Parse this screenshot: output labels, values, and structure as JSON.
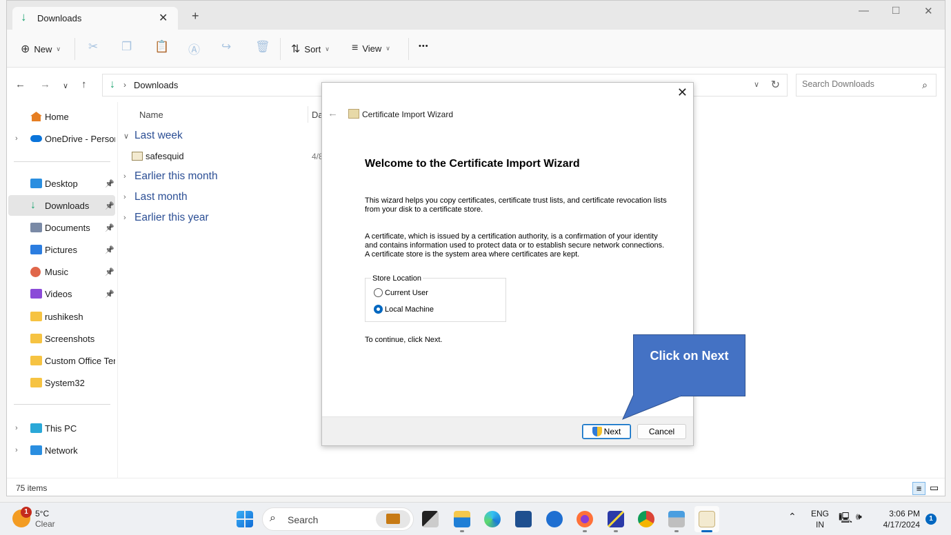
{
  "window": {
    "tab_title": "Downloads",
    "new_tab_label": "+",
    "controls": {
      "minimize": "—",
      "maximize": "□",
      "close": "✕"
    }
  },
  "toolbar": {
    "new_label": "New",
    "sort_label": "Sort",
    "view_label": "View",
    "more_label": "•••",
    "icons": [
      "cut-icon",
      "copy-icon",
      "paste-icon",
      "rename-icon",
      "share-icon",
      "delete-icon"
    ]
  },
  "address": {
    "path_separator": "›",
    "path": "Downloads",
    "search_placeholder": "Search Downloads"
  },
  "sidebar": {
    "items": [
      {
        "label": "Home",
        "icon": "home-icon",
        "color": "#e67e22"
      },
      {
        "label": "OneDrive - Persona",
        "icon": "onedrive-icon",
        "color": "#0a74da",
        "expandable": true
      },
      {
        "label": "Desktop",
        "icon": "desktop-icon",
        "color": "#2a8ee0",
        "pinned": true
      },
      {
        "label": "Downloads",
        "icon": "downloads-icon",
        "color": "#1aa36f",
        "pinned": true,
        "selected": true
      },
      {
        "label": "Documents",
        "icon": "documents-icon",
        "color": "#7a8aa6",
        "pinned": true
      },
      {
        "label": "Pictures",
        "icon": "pictures-icon",
        "color": "#2b7de0",
        "pinned": true
      },
      {
        "label": "Music",
        "icon": "music-icon",
        "color": "#e0664a",
        "pinned": true
      },
      {
        "label": "Videos",
        "icon": "videos-icon",
        "color": "#8b4ad8",
        "pinned": true
      },
      {
        "label": "rushikesh",
        "icon": "folder-icon",
        "color": "#f6c342"
      },
      {
        "label": "Screenshots",
        "icon": "folder-icon",
        "color": "#f6c342"
      },
      {
        "label": "Custom Office Tem",
        "icon": "folder-icon",
        "color": "#f6c342"
      },
      {
        "label": "System32",
        "icon": "folder-icon",
        "color": "#f6c342"
      },
      {
        "label": "This PC",
        "icon": "this-pc-icon",
        "color": "#2aa8d8",
        "expandable": true
      },
      {
        "label": "Network",
        "icon": "network-icon",
        "color": "#2a8ee0",
        "expandable": true
      }
    ]
  },
  "content": {
    "columns": {
      "name": "Name",
      "date": "Dat"
    },
    "groups": [
      {
        "label": "Last week",
        "expanded": true,
        "files": [
          {
            "name": "safesquid",
            "date": "4/8"
          }
        ]
      },
      {
        "label": "Earlier this month",
        "expanded": false
      },
      {
        "label": "Last month",
        "expanded": false
      },
      {
        "label": "Earlier this year",
        "expanded": false
      }
    ]
  },
  "status": {
    "item_count": "75 items"
  },
  "dialog": {
    "title": "Certificate Import Wizard",
    "heading": "Welcome to the Certificate Import Wizard",
    "para1": "This wizard helps you copy certificates, certificate trust lists, and certificate revocation lists from your disk to a certificate store.",
    "para2": "A certificate, which is issued by a certification authority, is a confirmation of your identity and contains information used to protect data or to establish secure network connections. A certificate store is the system area where certificates are kept.",
    "store_location_label": "Store Location",
    "options": [
      {
        "label": "Current User",
        "selected": false
      },
      {
        "label": "Local Machine",
        "selected": true
      }
    ],
    "continue_text": "To continue, click Next.",
    "next_label": "Next",
    "cancel_label": "Cancel"
  },
  "callout": {
    "text": "Click on Next",
    "color": "#4472c4"
  },
  "taskbar": {
    "weather": {
      "temp": "5°C",
      "condition": "Clear",
      "badge": "1"
    },
    "search_label": "Search",
    "apps": [
      "start-icon",
      "task-view-icon",
      "file-explorer-icon",
      "edge-icon",
      "store-icon",
      "thunderbird-icon",
      "firefox-icon",
      "network-connections-icon",
      "chrome-icon",
      "certificate-manager-icon",
      "certificate-icon"
    ],
    "language": {
      "line1": "ENG",
      "line2": "IN"
    },
    "time": "3:06 PM",
    "date": "4/17/2024",
    "notification_count": "1"
  }
}
